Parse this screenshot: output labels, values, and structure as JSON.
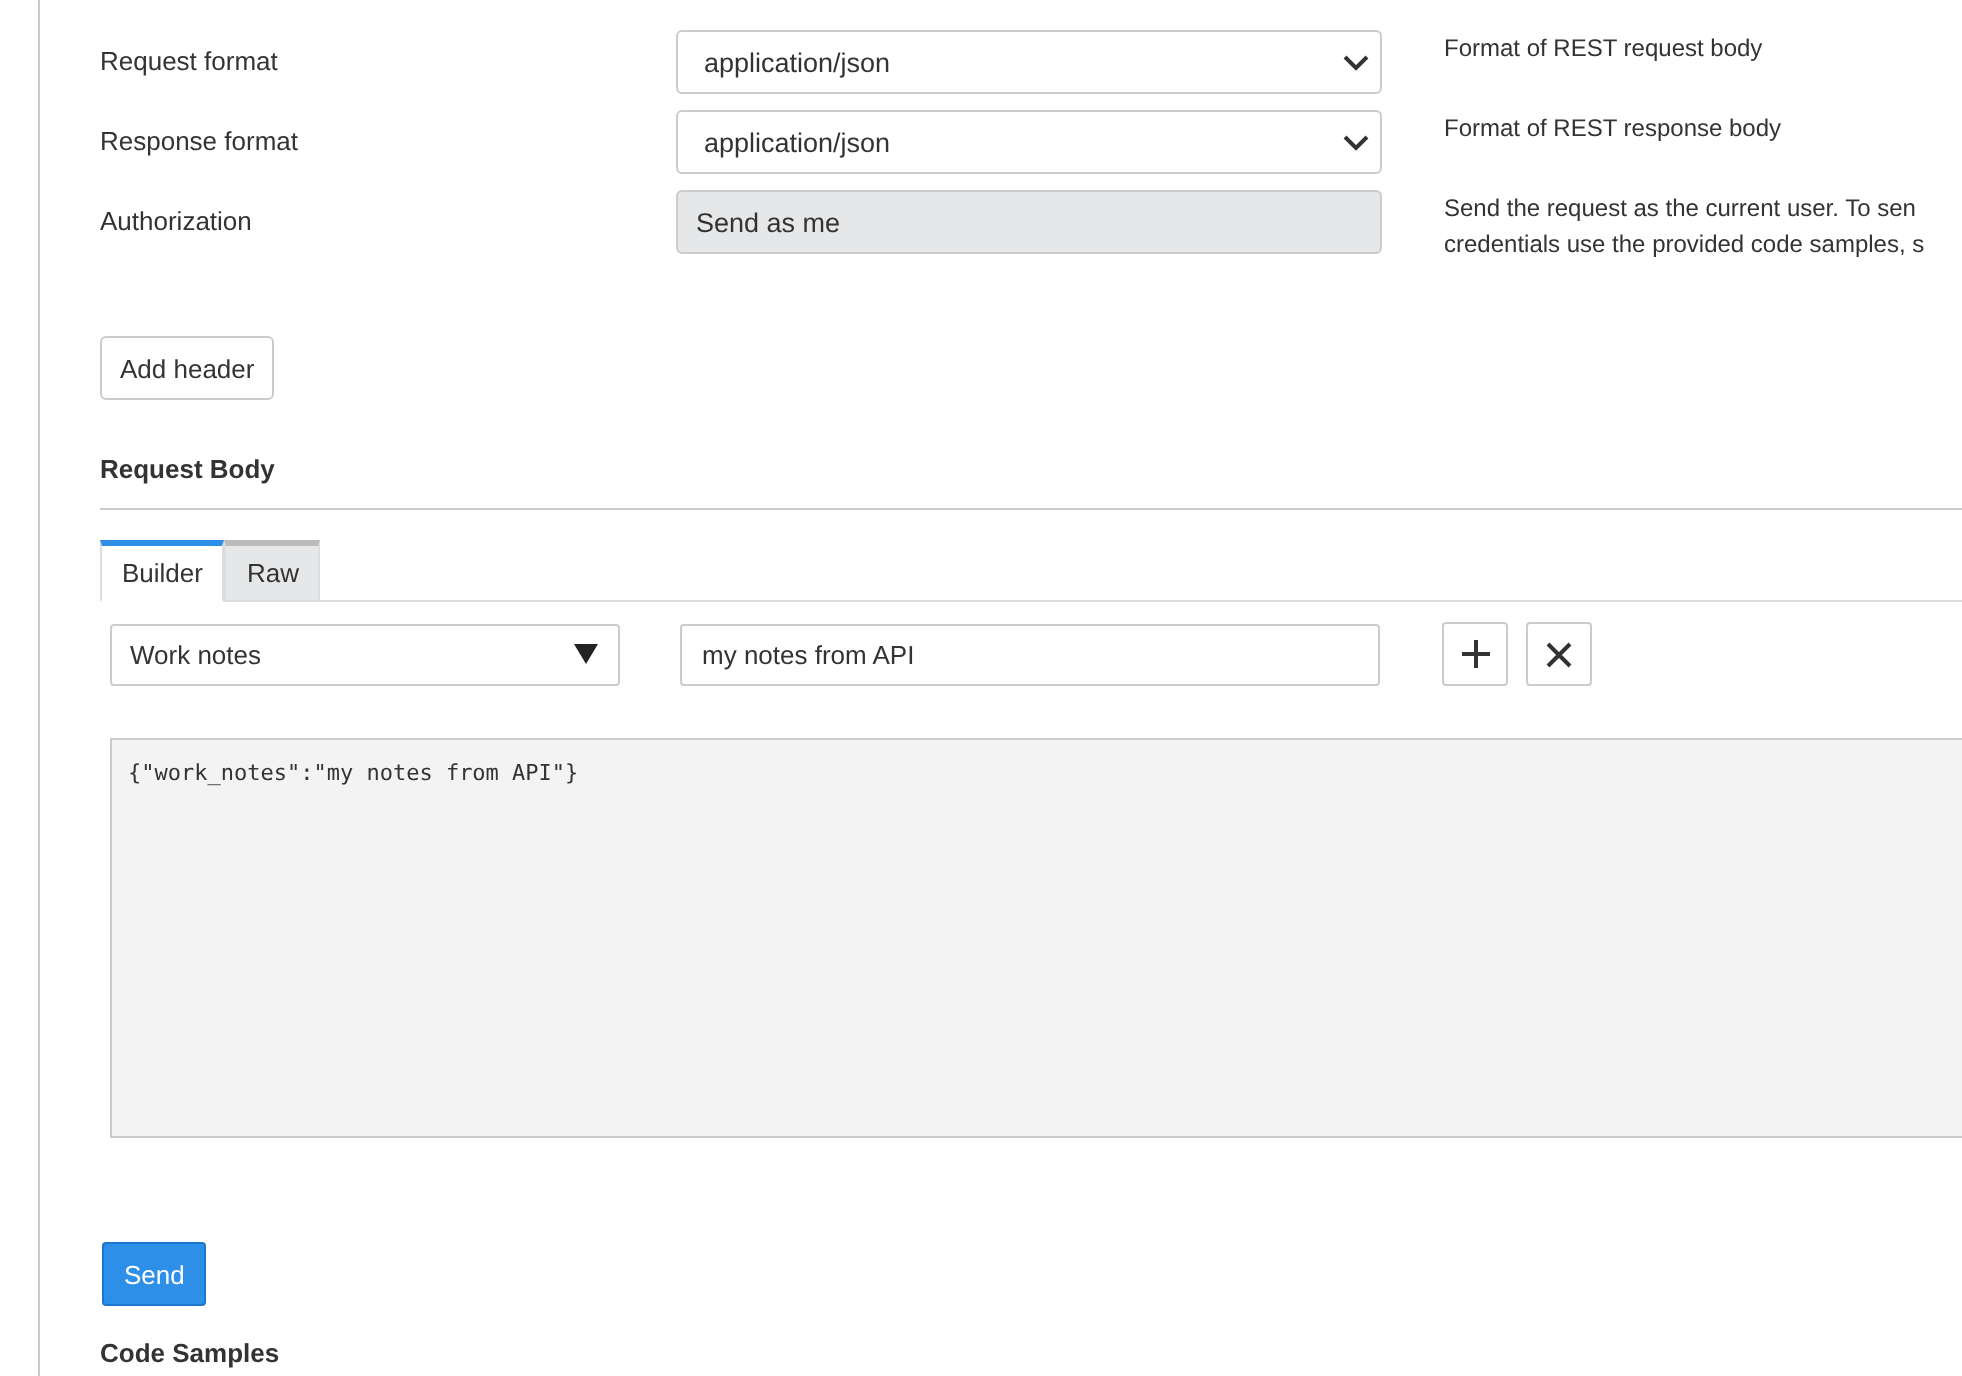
{
  "settings": [
    {
      "label": "Request format",
      "kind": "select",
      "value": "application/json",
      "description": [
        "Format of REST request body"
      ]
    },
    {
      "label": "Response format",
      "kind": "select",
      "value": "application/json",
      "description": [
        "Format of REST response body"
      ]
    },
    {
      "label": "Authorization",
      "kind": "readonly",
      "value": "Send as me",
      "description": [
        "Send the request as the current user. To sen",
        "credentials use the provided code samples, s"
      ]
    }
  ],
  "add_header_button": "Add header",
  "request_body": {
    "title": "Request Body",
    "tabs": [
      {
        "label": "Builder",
        "selected": true
      },
      {
        "label": "Raw",
        "selected": false
      }
    ],
    "field_select": "Work notes",
    "field_value": "my notes from API",
    "json_preview": "{\"work_notes\":\"my notes from API\"}"
  },
  "send_button": "Send",
  "code_samples_title": "Code Samples"
}
